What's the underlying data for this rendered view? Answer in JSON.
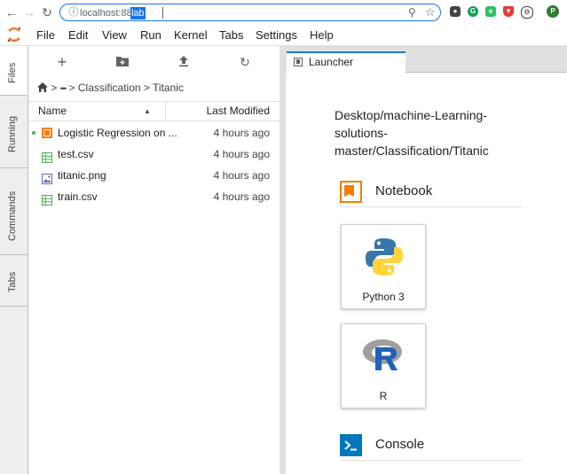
{
  "browser": {
    "url_host": "localhost:8888/",
    "url_path": "lab"
  },
  "menubar": {
    "items": [
      "File",
      "Edit",
      "View",
      "Run",
      "Kernel",
      "Tabs",
      "Settings",
      "Help"
    ]
  },
  "sidebar": {
    "tabs": [
      "Files",
      "Running",
      "Commands",
      "Tabs"
    ]
  },
  "filebrowser": {
    "breadcrumb": {
      "ellipsis": "•••",
      "sep1": ">",
      "sep2": ">",
      "folder1": "Classification",
      "sep3": ">",
      "folder2": "Titanic"
    },
    "columns": {
      "name": "Name",
      "modified": "Last Modified"
    },
    "files": [
      {
        "name": "Logistic Regression on ...",
        "modified": "4 hours ago",
        "type": "notebook",
        "running": true
      },
      {
        "name": "test.csv",
        "modified": "4 hours ago",
        "type": "csv",
        "running": false
      },
      {
        "name": "titanic.png",
        "modified": "4 hours ago",
        "type": "image",
        "running": false
      },
      {
        "name": "train.csv",
        "modified": "4 hours ago",
        "type": "csv",
        "running": false
      }
    ]
  },
  "main": {
    "tab_label": "Launcher",
    "cwd": "Desktop/machine-Learning-solutions-master/Classification/Titanic",
    "sections": {
      "notebook": "Notebook",
      "console": "Console"
    },
    "kernels": [
      {
        "label": "Python 3"
      },
      {
        "label": "R"
      }
    ]
  },
  "colors": {
    "accent": "#1976d2",
    "notebook_orange": "#f57c00",
    "csv_green": "#4caf50",
    "console_blue": "#0277bd"
  }
}
